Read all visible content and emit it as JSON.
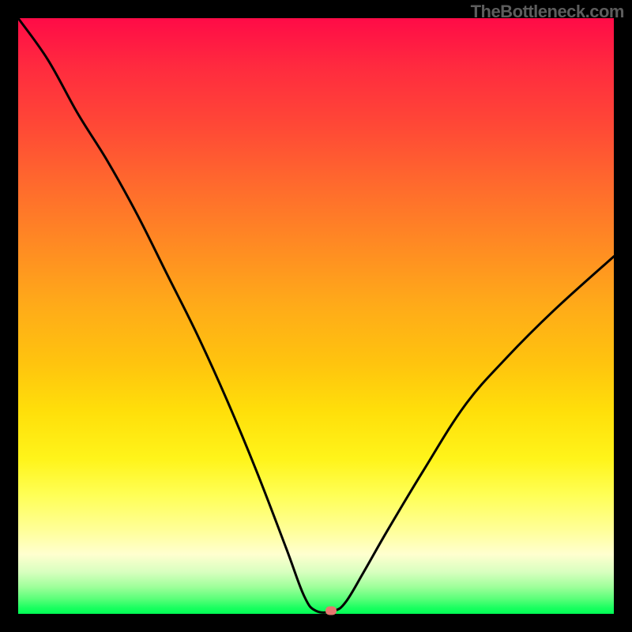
{
  "watermark": "TheBottleneck.com",
  "chart_data": {
    "type": "line",
    "title": "",
    "xlabel": "",
    "ylabel": "",
    "xlim": [
      0,
      100
    ],
    "ylim": [
      0,
      100
    ],
    "grid": false,
    "legend": false,
    "marker": {
      "x": 52.5,
      "y": 0.5,
      "color": "#e6776f"
    },
    "gradient_stops": [
      {
        "pct": 0,
        "color": "#ff0b47"
      },
      {
        "pct": 18,
        "color": "#ff4836"
      },
      {
        "pct": 38,
        "color": "#ff8a23"
      },
      {
        "pct": 58,
        "color": "#ffc40e"
      },
      {
        "pct": 74,
        "color": "#fff41a"
      },
      {
        "pct": 86,
        "color": "#ffff99"
      },
      {
        "pct": 93,
        "color": "#d8ffbf"
      },
      {
        "pct": 97,
        "color": "#5aff79"
      },
      {
        "pct": 100,
        "color": "#00ff55"
      }
    ],
    "series": [
      {
        "name": "bottleneck-curve",
        "x": [
          0,
          5,
          10,
          15,
          20,
          25,
          30,
          35,
          40,
          45,
          48,
          50,
          53,
          55,
          58,
          62,
          68,
          75,
          82,
          90,
          100
        ],
        "y": [
          100,
          93,
          84,
          76,
          67,
          57,
          47,
          36,
          24,
          11,
          3,
          0.5,
          0.5,
          2,
          7,
          14,
          24,
          35,
          43,
          51,
          60
        ]
      }
    ]
  }
}
